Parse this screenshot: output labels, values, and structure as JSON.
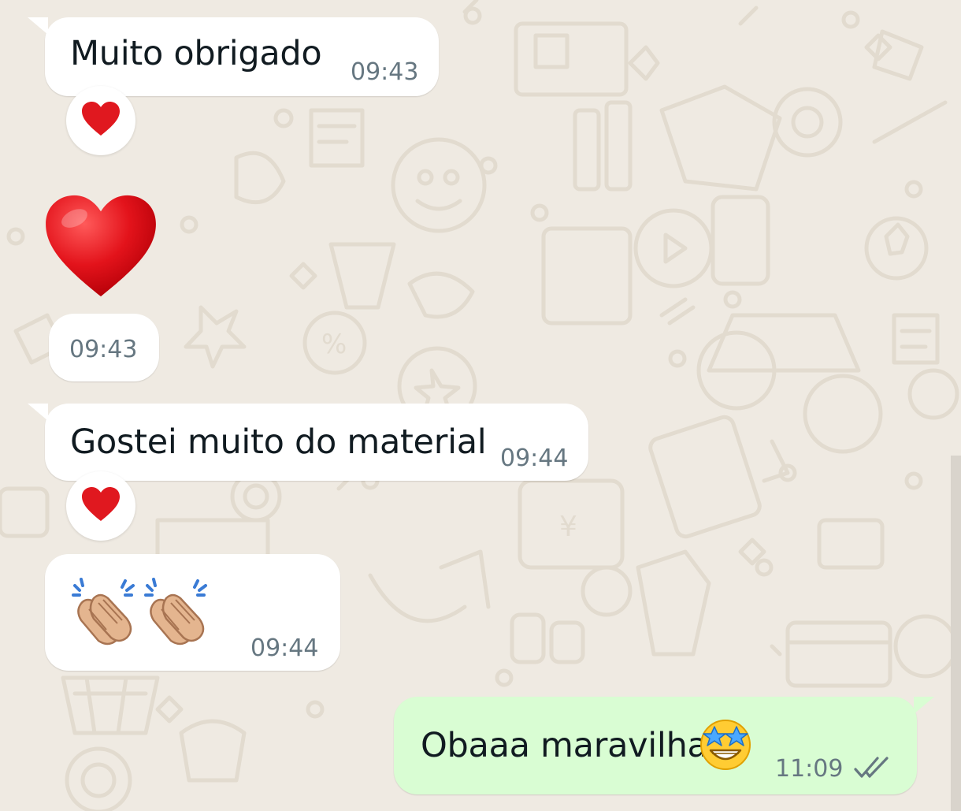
{
  "chat": {
    "messages": [
      {
        "direction": "incoming",
        "text": "Muito obrigado",
        "time": "09:43",
        "reaction": "red-heart-icon"
      },
      {
        "direction": "incoming",
        "emoji": "red-heart-icon",
        "time": "09:43"
      },
      {
        "direction": "incoming",
        "text": "Gostei muito do material",
        "time": "09:44",
        "reaction": "red-heart-icon"
      },
      {
        "direction": "incoming",
        "emoji": "clapping-hands-icon x2",
        "time": "09:44"
      },
      {
        "direction": "outgoing",
        "text": "Obaaa maravilha",
        "emoji": "star-struck-icon",
        "time": "11:09",
        "status": "read-double-check-icon"
      }
    ]
  },
  "colors": {
    "wallpaper": "#efeae2",
    "incoming_bubble": "#ffffff",
    "outgoing_bubble": "#d9fdd3",
    "text": "#111b21",
    "timestamp": "#667781",
    "heart": "#e0181f"
  }
}
